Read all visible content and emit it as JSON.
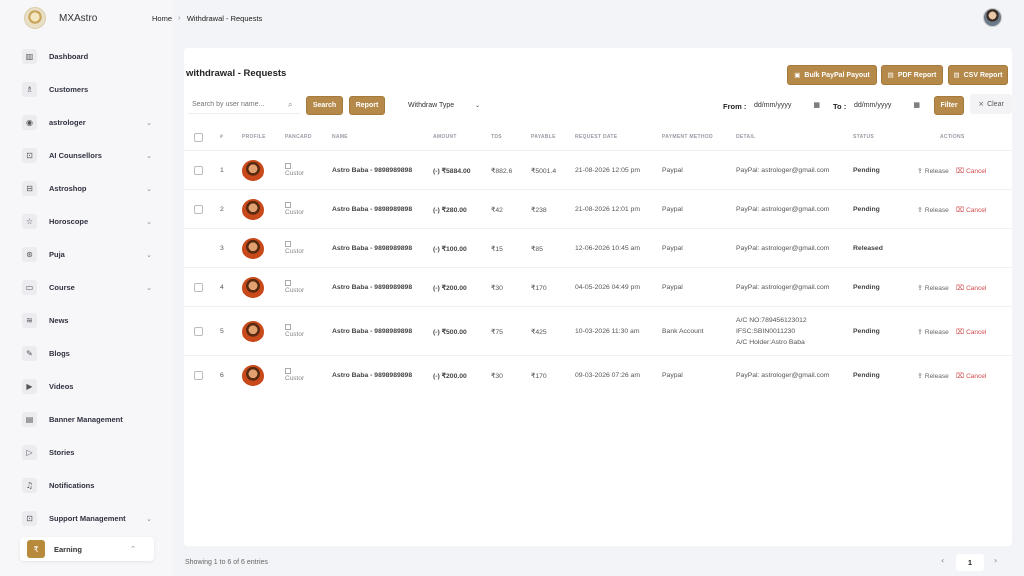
{
  "brand": {
    "name": "MXAstro"
  },
  "breadcrumb": {
    "home": "Home",
    "sep": "›",
    "current": "Withdrawal - Requests"
  },
  "sidebar": {
    "items": [
      {
        "label": "Dashboard",
        "icon": "▥",
        "chevron": false
      },
      {
        "label": "Customers",
        "icon": "♗",
        "chevron": false
      },
      {
        "label": "astrologer",
        "icon": "◉",
        "chevron": true
      },
      {
        "label": "AI Counsellors",
        "icon": "⊡",
        "chevron": true
      },
      {
        "label": "Astroshop",
        "icon": "⊟",
        "chevron": true
      },
      {
        "label": "Horoscope",
        "icon": "☆",
        "chevron": true
      },
      {
        "label": "Puja",
        "icon": "⊛",
        "chevron": true
      },
      {
        "label": "Course",
        "icon": "▭",
        "chevron": true
      },
      {
        "label": "News",
        "icon": "≋",
        "chevron": false
      },
      {
        "label": "Blogs",
        "icon": "✎",
        "chevron": false
      },
      {
        "label": "Videos",
        "icon": "▶",
        "chevron": false
      },
      {
        "label": "Banner Management",
        "icon": "▤",
        "chevron": false
      },
      {
        "label": "Stories",
        "icon": "▷",
        "chevron": false
      },
      {
        "label": "Notifications",
        "icon": "♫",
        "chevron": false
      },
      {
        "label": "Support Management",
        "icon": "⊡",
        "chevron": true
      }
    ],
    "active": {
      "label": "Earning",
      "icon": "₹",
      "chevron": "⌃"
    },
    "chevron_glyph": "⌄"
  },
  "page": {
    "title": "withdrawal - Requests",
    "buttons": {
      "bulk_paypal": "Bulk PayPal Payout",
      "pdf_report": "PDF Report",
      "csv_report": "CSV Report",
      "search": "Search",
      "report": "Report",
      "filter": "Filter",
      "clear": "Clear"
    },
    "search_placeholder": "Search by user name...",
    "withdraw_type": "Withdraw Type",
    "from_label": "From :",
    "to_label": "To :",
    "date_placeholder": "dd/mm/yyyy"
  },
  "table": {
    "headers": [
      "#",
      "PROFILE",
      "PANCARD",
      "NAME",
      "AMOUNT",
      "TDS",
      "PAYABLE",
      "REQUEST DATE",
      "PAYMENT METHOD",
      "DETAIL",
      "STATUS",
      "ACTIONS"
    ],
    "pancard_alt": "Custor",
    "release_label": "Release",
    "cancel_label": "Cancel",
    "rows": [
      {
        "num": "1",
        "name": "Astro Baba - 9898989898",
        "amount": "(-) ₹5884.00",
        "tds": "₹882.6",
        "payable": "₹5001.4",
        "date": "21-08-2026 12:05 pm",
        "method": "Paypal",
        "detail": [
          "PayPal: astrologer@gmail.com"
        ],
        "status": "Pending",
        "checkbox": true,
        "actions": true
      },
      {
        "num": "2",
        "name": "Astro Baba - 9898989898",
        "amount": "(-) ₹280.00",
        "tds": "₹42",
        "payable": "₹238",
        "date": "21-08-2026 12:01 pm",
        "method": "Paypal",
        "detail": [
          "PayPal: astrologer@gmail.com"
        ],
        "status": "Pending",
        "checkbox": true,
        "actions": true
      },
      {
        "num": "3",
        "name": "Astro Baba - 9898989898",
        "amount": "(-) ₹100.00",
        "tds": "₹15",
        "payable": "₹85",
        "date": "12-06-2026 10:45 am",
        "method": "Paypal",
        "detail": [
          "PayPal: astrologer@gmail.com"
        ],
        "status": "Released",
        "checkbox": false,
        "actions": false
      },
      {
        "num": "4",
        "name": "Astro Baba - 9898989898",
        "amount": "(-) ₹200.00",
        "tds": "₹30",
        "payable": "₹170",
        "date": "04-05-2026 04:49 pm",
        "method": "Paypal",
        "detail": [
          "PayPal: astrologer@gmail.com"
        ],
        "status": "Pending",
        "checkbox": true,
        "actions": true
      },
      {
        "num": "5",
        "name": "Astro Baba - 9898989898",
        "amount": "(-) ₹500.00",
        "tds": "₹75",
        "payable": "₹425",
        "date": "10-03-2026 11:30 am",
        "method": "Bank Account",
        "detail": [
          "A/C NO:789456123012",
          "IFSC:SBIN0011230",
          "A/C Holder:Astro Baba"
        ],
        "status": "Pending",
        "checkbox": true,
        "actions": true
      },
      {
        "num": "6",
        "name": "Astro Baba - 9898989898",
        "amount": "(-) ₹200.00",
        "tds": "₹30",
        "payable": "₹170",
        "date": "09-03-2026 07:26 am",
        "method": "Paypal",
        "detail": [
          "PayPal: astrologer@gmail.com"
        ],
        "status": "Pending",
        "checkbox": true,
        "actions": true
      }
    ]
  },
  "footer": {
    "info": "Showing 1 to 6 of 6 entries",
    "page": "1",
    "prev": "‹",
    "next": "›"
  },
  "colors": {
    "accent": "#b5894a"
  }
}
